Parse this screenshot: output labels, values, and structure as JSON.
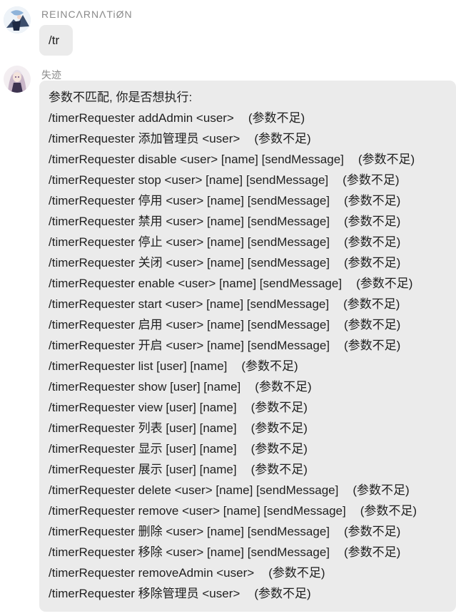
{
  "messages": [
    {
      "sender": "REINCΛRNΛTiØN",
      "text": "/tr"
    },
    {
      "sender": "失迹",
      "header": "参数不匹配, 你是否想执行:",
      "lines": [
        {
          "cmd": "/timerRequester addAdmin <user>",
          "hint": "(参数不足)"
        },
        {
          "cmd": "/timerRequester 添加管理员 <user>",
          "hint": "(参数不足)"
        },
        {
          "cmd": "/timerRequester disable <user> [name] [sendMessage]",
          "hint": "(参数不足)"
        },
        {
          "cmd": "/timerRequester stop <user> [name] [sendMessage]",
          "hint": "(参数不足)"
        },
        {
          "cmd": "/timerRequester 停用 <user> [name] [sendMessage]",
          "hint": "(参数不足)"
        },
        {
          "cmd": "/timerRequester 禁用 <user> [name] [sendMessage]",
          "hint": "(参数不足)"
        },
        {
          "cmd": "/timerRequester 停止 <user> [name] [sendMessage]",
          "hint": "(参数不足)"
        },
        {
          "cmd": "/timerRequester 关闭 <user> [name] [sendMessage]",
          "hint": "(参数不足)"
        },
        {
          "cmd": "/timerRequester enable <user> [name] [sendMessage]",
          "hint": "(参数不足)"
        },
        {
          "cmd": "/timerRequester start <user> [name] [sendMessage]",
          "hint": "(参数不足)"
        },
        {
          "cmd": "/timerRequester 启用 <user> [name] [sendMessage]",
          "hint": "(参数不足)"
        },
        {
          "cmd": "/timerRequester 开启 <user> [name] [sendMessage]",
          "hint": "(参数不足)"
        },
        {
          "cmd": "/timerRequester list [user] [name]",
          "hint": "(参数不足)"
        },
        {
          "cmd": "/timerRequester show [user] [name]",
          "hint": "(参数不足)"
        },
        {
          "cmd": "/timerRequester view [user] [name]",
          "hint": "(参数不足)"
        },
        {
          "cmd": "/timerRequester 列表 [user] [name]",
          "hint": "(参数不足)"
        },
        {
          "cmd": "/timerRequester 显示 [user] [name]",
          "hint": "(参数不足)"
        },
        {
          "cmd": "/timerRequester 展示 [user] [name]",
          "hint": "(参数不足)"
        },
        {
          "cmd": "/timerRequester delete <user> [name] [sendMessage]",
          "hint": "(参数不足)"
        },
        {
          "cmd": "/timerRequester remove <user> [name] [sendMessage]",
          "hint": "(参数不足)"
        },
        {
          "cmd": "/timerRequester 删除 <user> [name] [sendMessage]",
          "hint": "(参数不足)"
        },
        {
          "cmd": "/timerRequester 移除 <user> [name] [sendMessage]",
          "hint": "(参数不足)"
        },
        {
          "cmd": "/timerRequester removeAdmin <user>",
          "hint": "(参数不足)"
        },
        {
          "cmd": "/timerRequester 移除管理员 <user>",
          "hint": "(参数不足)"
        }
      ]
    }
  ],
  "colors": {
    "bubble_bg": "#ebebeb",
    "sender_text": "#8a8a8a",
    "message_text": "#1f1f1f"
  }
}
